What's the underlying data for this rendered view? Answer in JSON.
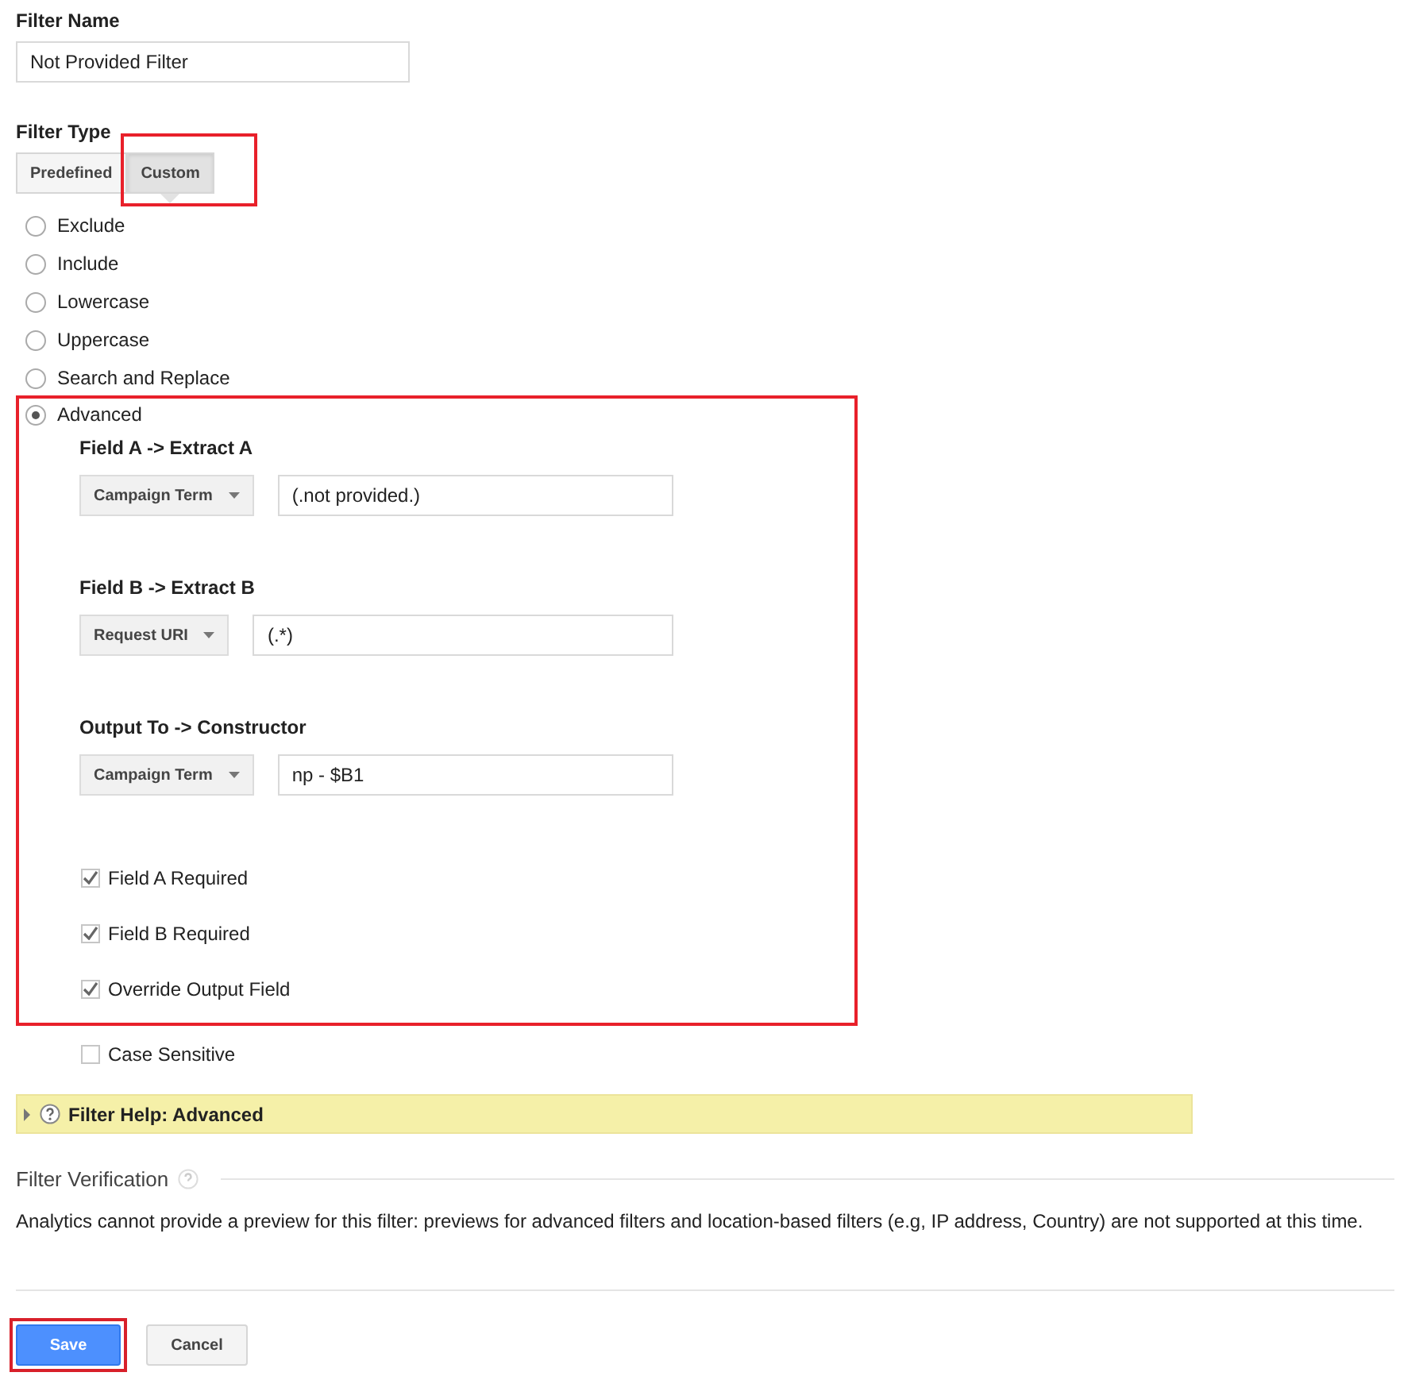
{
  "filter_name": {
    "label": "Filter Name",
    "value": "Not Provided Filter"
  },
  "filter_type": {
    "label": "Filter Type",
    "options": [
      {
        "label": "Predefined",
        "selected": false,
        "highlighted": false
      },
      {
        "label": "Custom",
        "selected": true,
        "highlighted": true
      }
    ]
  },
  "types": [
    {
      "label": "Exclude",
      "selected": false
    },
    {
      "label": "Include",
      "selected": false
    },
    {
      "label": "Lowercase",
      "selected": false
    },
    {
      "label": "Uppercase",
      "selected": false
    },
    {
      "label": "Search and Replace",
      "selected": false
    },
    {
      "label": "Advanced",
      "selected": true
    }
  ],
  "advanced": {
    "highlighted": true,
    "fields": [
      {
        "label": "Field A -> Extract A",
        "dropdown": "Campaign Term",
        "value": "(.not provided.)"
      },
      {
        "label": "Field B -> Extract B",
        "dropdown": "Request URI",
        "value": "(.*)"
      },
      {
        "label": "Output To -> Constructor",
        "dropdown": "Campaign Term",
        "value": "np - $B1"
      }
    ],
    "options": [
      {
        "label": "Field A Required",
        "checked": true
      },
      {
        "label": "Field B Required",
        "checked": true
      },
      {
        "label": "Override Output Field",
        "checked": true
      }
    ]
  },
  "case_sensitive": {
    "label": "Case Sensitive",
    "checked": false
  },
  "help": {
    "label": "Filter Help: Advanced",
    "expanded": false
  },
  "verification": {
    "title": "Filter Verification",
    "message": "Analytics cannot provide a preview for this filter: previews for advanced filters and location-based filters (e.g, IP address, Country) are not supported at this time."
  },
  "buttons": [
    {
      "label": "Save",
      "kind": "primary",
      "highlighted": true
    },
    {
      "label": "Cancel",
      "kind": "secondary",
      "highlighted": false
    }
  ]
}
